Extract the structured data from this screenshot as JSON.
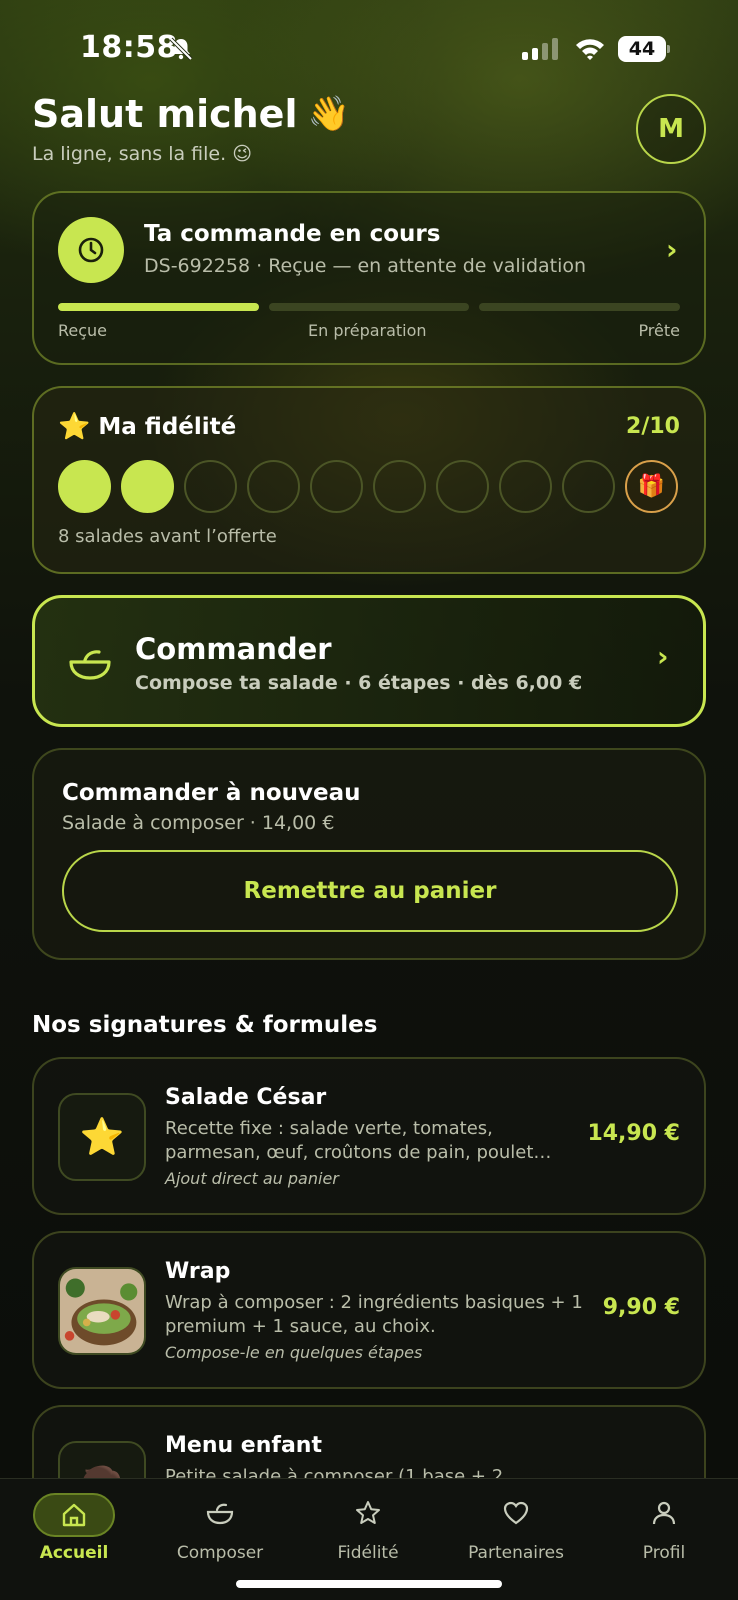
{
  "status": {
    "time": "18:58",
    "battery": "44"
  },
  "header": {
    "greeting": "Salut michel",
    "wave": "👋",
    "subtitle": "La ligne, sans la file.",
    "subtitle_emoji": "😉",
    "avatar": "M"
  },
  "order": {
    "title": "Ta commande en cours",
    "subtitle": "DS-692258 · Reçue — en attente de validation",
    "steps": [
      "Reçue",
      "En préparation",
      "Prête"
    ],
    "progress_steps_done": 1,
    "progress_steps_total": 3
  },
  "fidelity": {
    "title": "Ma fidélité",
    "count": "2/10",
    "filled": 2,
    "total": 10,
    "note": "8 salades avant l’offerte"
  },
  "commander": {
    "title": "Commander",
    "subtitle": "Compose ta salade · 6 étapes · dès 6,00 €"
  },
  "reorder": {
    "title": "Commander à nouveau",
    "subtitle": "Salade à composer · 14,00 €",
    "button": "Remettre au panier"
  },
  "section_title": "Nos signatures & formules",
  "items": [
    {
      "name": "Salade César",
      "desc": "Recette fixe : salade verte, tomates, parmesan, œuf, croûtons de pain, poulet…",
      "note": "Ajout direct au panier",
      "price": "14,90 €",
      "icon": "star-icon"
    },
    {
      "name": "Wrap",
      "desc": "Wrap à composer : 2 ingrédients basiques + 1 premium + 1 sauce, au choix.",
      "note": "Compose-le en quelques étapes",
      "price": "9,90 €",
      "icon": "salad-photo"
    },
    {
      "name": "Menu enfant",
      "desc": "Petite salade à composer (1 base + 2",
      "note": "",
      "price": "",
      "icon": "child-menu-icon"
    }
  ],
  "tabs": [
    {
      "label": "Accueil",
      "icon": "home-icon",
      "active": true
    },
    {
      "label": "Composer",
      "icon": "bowl-icon",
      "active": false
    },
    {
      "label": "Fidélité",
      "icon": "star-icon",
      "active": false
    },
    {
      "label": "Partenaires",
      "icon": "heart-icon",
      "active": false
    },
    {
      "label": "Profil",
      "icon": "user-icon",
      "active": false
    }
  ],
  "colors": {
    "accent": "#c8e650",
    "background": "#0c0e0b"
  }
}
